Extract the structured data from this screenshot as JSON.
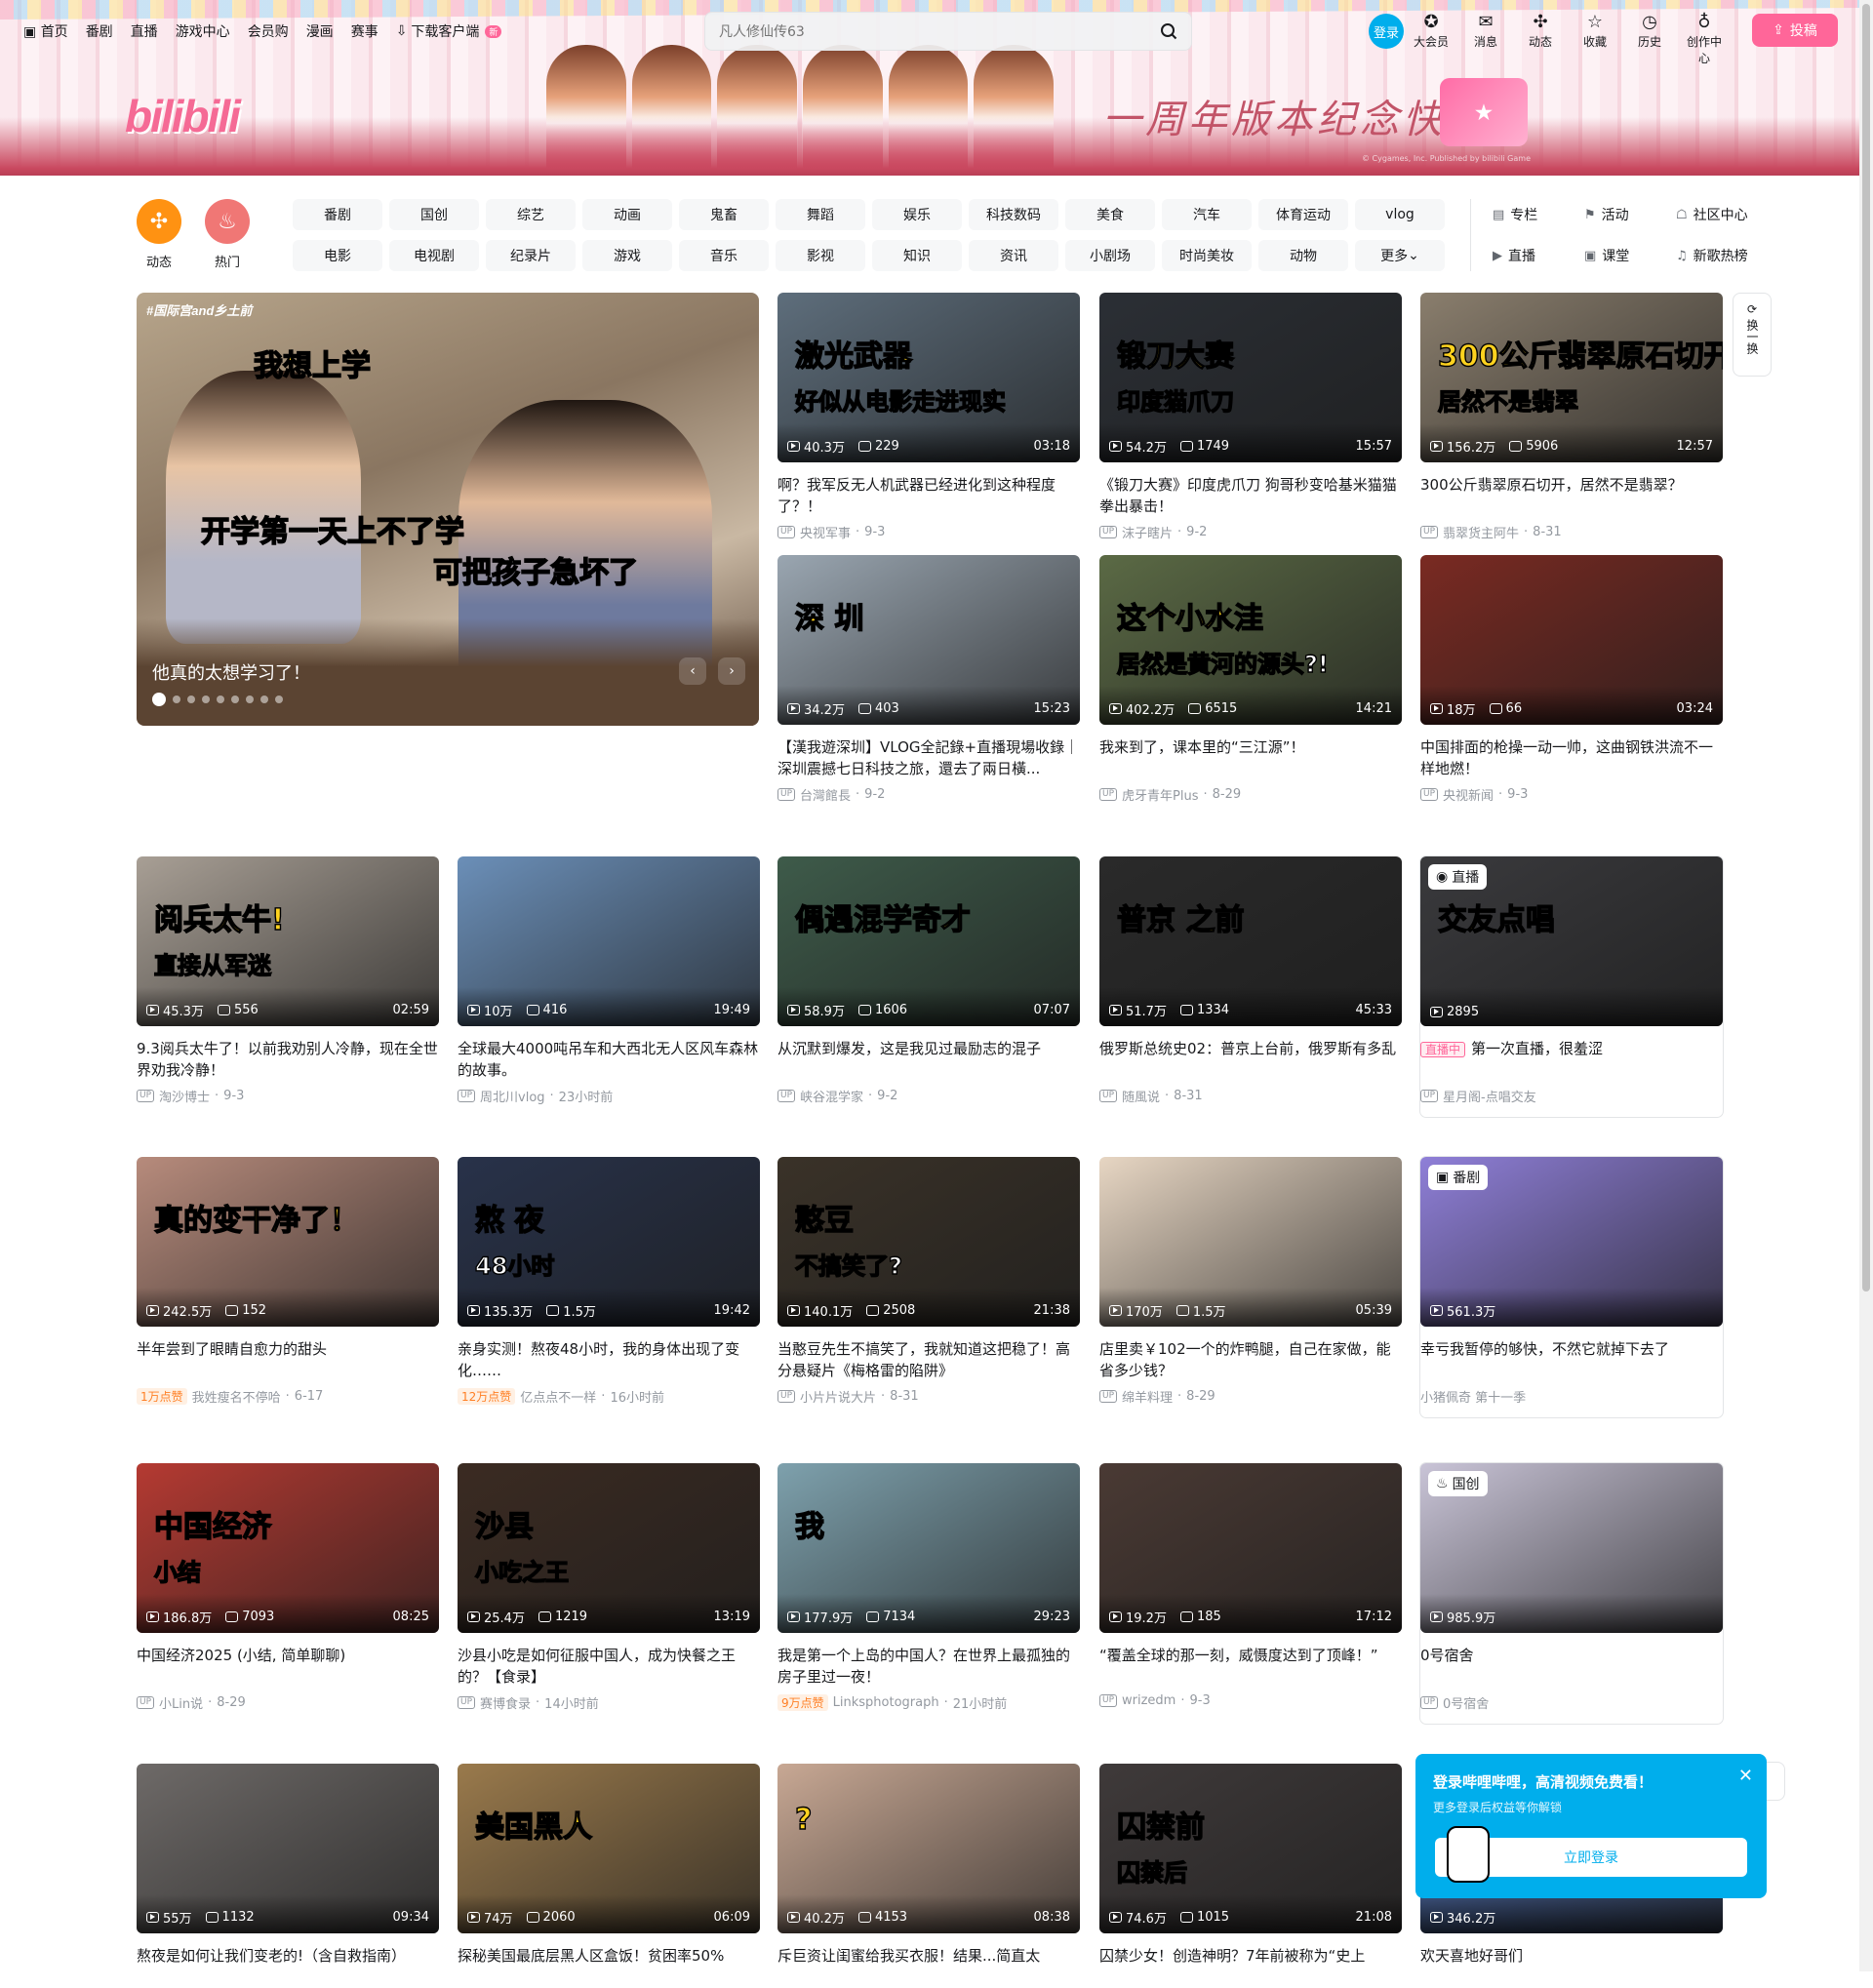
{
  "topnav": {
    "items": [
      "首页",
      "番剧",
      "直播",
      "游戏中心",
      "会员购",
      "漫画",
      "赛事"
    ],
    "download": "下载客户端",
    "download_badge": "新"
  },
  "search": {
    "placeholder": "凡人修仙传63"
  },
  "header": {
    "login": "登录",
    "icons": [
      {
        "label": "大会员",
        "icon": "vip-icon"
      },
      {
        "label": "消息",
        "icon": "message-icon"
      },
      {
        "label": "动态",
        "icon": "dynamic-icon"
      },
      {
        "label": "收藏",
        "icon": "star-icon"
      },
      {
        "label": "历史",
        "icon": "history-icon"
      },
      {
        "label": "创作中心",
        "icon": "creator-icon"
      }
    ],
    "upload": "投稿"
  },
  "banner": {
    "slogan": "一周年版本纪念快乐！",
    "copyright": "© Cygames, Inc. Published by bilibili Game"
  },
  "channels": {
    "round": [
      {
        "label": "动态",
        "icon": "dynamic-icon",
        "color": "#ff9212"
      },
      {
        "label": "热门",
        "icon": "fire-icon",
        "color": "#f07775"
      }
    ],
    "grid": [
      "番剧",
      "国创",
      "综艺",
      "动画",
      "鬼畜",
      "舞蹈",
      "娱乐",
      "科技数码",
      "美食",
      "汽车",
      "体育运动",
      "vlog",
      "电影",
      "电视剧",
      "纪录片",
      "游戏",
      "音乐",
      "影视",
      "知识",
      "资讯",
      "小剧场",
      "时尚美妆",
      "动物",
      "更多"
    ],
    "right": [
      {
        "label": "专栏",
        "icon": "column-icon"
      },
      {
        "label": "活动",
        "icon": "flag-icon"
      },
      {
        "label": "社区中心",
        "icon": "community-icon"
      },
      {
        "label": "直播",
        "icon": "live-icon"
      },
      {
        "label": "课堂",
        "icon": "class-icon"
      },
      {
        "label": "新歌热榜",
        "icon": "music-chart-icon"
      }
    ]
  },
  "carousel": {
    "tag": "#国际宫and乡土前",
    "overlay1": "我想上学",
    "overlay2a": "开学第一天",
    "overlay2b": "上不了学",
    "overlay3a": "可把孩子",
    "overlay3b": "急坏了",
    "caption": "他真的太想学习了！",
    "dot_count": 9
  },
  "refresh": {
    "label": "换一换"
  },
  "cards": [
    {
      "views": "40.3万",
      "danmaku": "229",
      "dur": "03:18",
      "title": "啊？我军反无人机武器已经进化到这种程度了？！",
      "up": "央视军事",
      "date": "9-3",
      "overlay": "激光武器",
      "overlay2": "好似从电影走进现实",
      "bg": "#5e6e7c"
    },
    {
      "views": "54.2万",
      "danmaku": "1749",
      "dur": "15:57",
      "title": "《锻刀大赛》印度虎爪刀 狗哥秒变哈基米猫猫拳出暴击！",
      "up": "沫子瞎片",
      "date": "9-2",
      "overlay": "锻刀大赛",
      "overlay2": "印度猫爪刀",
      "bg": "#2b2f35"
    },
    {
      "views": "156.2万",
      "danmaku": "5906",
      "dur": "12:57",
      "title": "300公斤翡翠原石切开，居然不是翡翠？",
      "up": "翡翠货主阿牛",
      "date": "8-31",
      "overlay": "300公斤翡翠原石切开",
      "overlay2": "居然不是翡翠",
      "bg": "#8a7e6d"
    },
    {
      "views": "34.2万",
      "danmaku": "403",
      "dur": "15:23",
      "title": "【漢我遊深圳】VLOG全記錄+直播現場收錄｜深圳震撼七日科技之旅，還去了兩日橫...",
      "up": "台灣館長",
      "date": "9-2",
      "overlay": "深  圳",
      "overlay2": "",
      "bg": "#9aa6b1"
    },
    {
      "views": "402.2万",
      "danmaku": "6515",
      "dur": "14:21",
      "title": "我来到了，课本里的“三江源”！",
      "up": "虎牙青年Plus",
      "date": "8-29",
      "overlay": "这个小水洼",
      "overlay2": "居然是黄河的源头?!",
      "bg": "#5b6a45"
    },
    {
      "views": "18万",
      "danmaku": "66",
      "dur": "03:24",
      "title": "中国排面的枪操一动一帅，这曲钢铁洪流不一样地燃！",
      "up": "央视新闻",
      "date": "9-3",
      "overlay": "",
      "overlay2": "",
      "bg": "#7a2a22"
    },
    {
      "views": "45.3万",
      "danmaku": "556",
      "dur": "02:59",
      "title": "9.3阅兵太牛了！以前我劝别人冷静，现在全世界劝我冷静！",
      "up": "淘沙博士",
      "date": "9-3",
      "overlay": "阅兵太牛!",
      "overlay2": "直接从军迷",
      "bg": "#a89f95"
    },
    {
      "views": "10万",
      "danmaku": "416",
      "dur": "19:49",
      "title": "全球最大4000吨吊车和大西北无人区风车森林的故事。",
      "up": "周北川vlog",
      "date": "23小时前",
      "overlay": "",
      "overlay2": "",
      "bg": "#6b8fb8"
    },
    {
      "views": "58.9万",
      "danmaku": "1606",
      "dur": "07:07",
      "title": "从沉默到爆发，这是我见过最励志的混子",
      "up": "峡谷混学家",
      "date": "9-2",
      "overlay": "偶遇混学奇才",
      "overlay2": "",
      "bg": "#3e5b4a"
    },
    {
      "views": "51.7万",
      "danmaku": "1334",
      "dur": "45:33",
      "title": "俄罗斯总统史02：普京上台前，俄罗斯有多乱",
      "up": "随風说",
      "date": "8-31",
      "overlay": "普京  之前",
      "overlay2": "",
      "bg": "#2a2a2a"
    },
    {
      "live": true,
      "views": "2895",
      "title": "第一次直播，很羞涩",
      "live_label": "直播中",
      "up": "星月阁-点唱交友",
      "corner": "直播",
      "overlay": "交友点唱",
      "bg": "#3a3a3d"
    },
    {
      "views": "242.5万",
      "danmaku": "152",
      "dur": "",
      "title": "半年尝到了眼睛自愈力的甜头",
      "likes": "1万点赞",
      "up": "我姓瘦名不停哈",
      "date": "6-17",
      "overlay": "真的变干净了！",
      "overlay2": "",
      "bg": "#b78b7c"
    },
    {
      "views": "135.3万",
      "danmaku": "1.5万",
      "dur": "19:42",
      "title": "亲身实测！熬夜48小时，我的身体出现了变化……",
      "likes": "12万点赞",
      "up": "亿点点不一样",
      "date": "16小时前",
      "overlay": "熬   夜",
      "overlay2": "48小时",
      "bg": "#28324a"
    },
    {
      "views": "140.1万",
      "danmaku": "2508",
      "dur": "21:38",
      "title": "当憨豆先生不搞笑了，我就知道这把稳了！高分悬疑片《梅格雷的陷阱》",
      "up": "小片片说大片",
      "date": "8-31",
      "overlay": "憨豆",
      "overlay2": "不搞笑了?",
      "bg": "#3a3228"
    },
    {
      "views": "170万",
      "danmaku": "1.5万",
      "dur": "05:39",
      "title": "店里卖￥102一个的炸鸭腿，自己在家做，能省多少钱？",
      "up": "绵羊料理",
      "date": "8-29",
      "overlay": "",
      "overlay2": "",
      "bg": "#e7d6c3"
    },
    {
      "bangumi": true,
      "views": "561.3万",
      "title": "幸亏我暂停的够快，不然它就掉下去了",
      "up": "小猪佩奇 第十一季",
      "corner": "番剧",
      "bg": "#8f7fd8"
    },
    {
      "views": "186.8万",
      "danmaku": "7093",
      "dur": "08:25",
      "title": "中国经济2025 (小结, 简单聊聊)",
      "up": "小Lin说",
      "date": "8-29",
      "overlay": "中国经济",
      "overlay2": "小结",
      "bg": "#b53a32"
    },
    {
      "views": "25.4万",
      "danmaku": "1219",
      "dur": "13:19",
      "title": "沙县小吃是如何征服中国人，成为快餐之王的？【食录】",
      "up": "赛博食录",
      "date": "14小时前",
      "overlay": "沙县",
      "overlay2": "小吃之王",
      "bg": "#3b2b22"
    },
    {
      "views": "177.9万",
      "danmaku": "7134",
      "dur": "29:23",
      "title": "我是第一个上岛的中国人？在世界上最孤独的房子里过一夜！",
      "likes": "9万点赞",
      "up": "Linksphotograph",
      "date": "21小时前",
      "overlay": "我",
      "overlay2": "",
      "bg": "#7ea1ad"
    },
    {
      "views": "19.2万",
      "danmaku": "185",
      "dur": "17:12",
      "title": "“覆盖全球的那一刻，威慑度达到了顶峰！”",
      "up": "wrizedm",
      "date": "9-3",
      "overlay": "",
      "overlay2": "",
      "bg": "#4a3a34"
    },
    {
      "guochuang": true,
      "views": "985.9万",
      "title": "0号宿舍",
      "up": "0号宿舍",
      "corner": "国创",
      "bg": "#c9c4d7"
    },
    {
      "views": "55万",
      "danmaku": "1132",
      "dur": "09:34",
      "title": "熬夜是如何让我们变老的!（含自救指南）",
      "up": "",
      "date": "",
      "overlay": "",
      "overlay2": "",
      "bg": "#6e6a68"
    },
    {
      "views": "74万",
      "danmaku": "2060",
      "dur": "06:09",
      "title": "探秘美国最底层黑人区盒饭！贫困率50%",
      "up": "",
      "date": "",
      "overlay": "美国黑人",
      "overlay2": "",
      "bg": "#9a7a4c"
    },
    {
      "views": "40.2万",
      "danmaku": "4153",
      "dur": "08:38",
      "title": "斥巨资让闺蜜给我买衣服！结果...简直太",
      "up": "",
      "date": "",
      "overlay": "?",
      "overlay2": "",
      "bg": "#c8a894"
    },
    {
      "views": "74.6万",
      "danmaku": "1015",
      "dur": "21:08",
      "title": "囚禁少女！创造神明？7年前被称为“史上",
      "up": "",
      "date": "",
      "overlay": "囚禁前",
      "overlay2": "囚禁后",
      "bg": "#3f3a3a"
    },
    {
      "views": "346.2万",
      "title": "欢天喜地好哥们",
      "up": "",
      "bg": "#4b6aa8"
    }
  ],
  "popup": {
    "title": "登录哔哩哔哩，高清视频免费看！",
    "sub": "更多登录后权益等你解锁",
    "button": "立即登录"
  }
}
